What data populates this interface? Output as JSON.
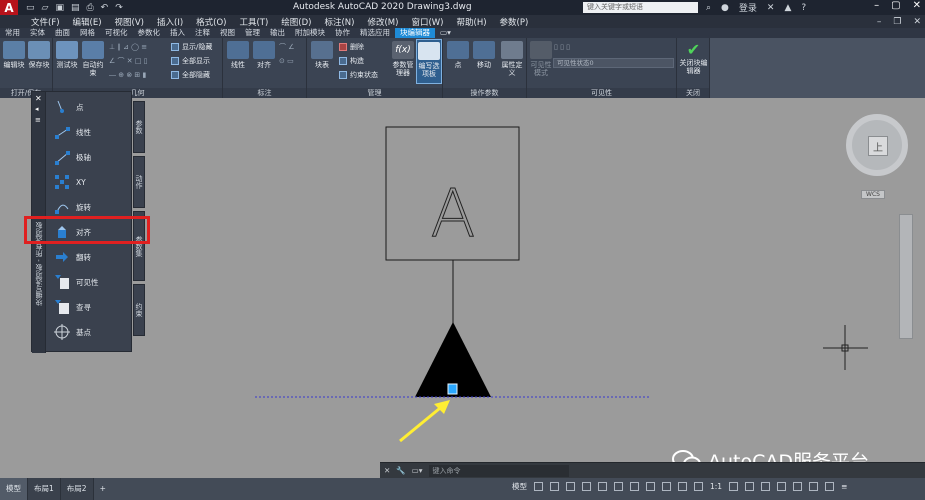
{
  "window": {
    "app_logo": "A",
    "title": "Autodesk AutoCAD 2020    Drawing3.dwg",
    "search_placeholder": "键入关键字或短语",
    "login": "登录",
    "help": "?"
  },
  "menu": [
    "文件(F)",
    "编辑(E)",
    "视图(V)",
    "插入(I)",
    "格式(O)",
    "工具(T)",
    "绘图(D)",
    "标注(N)",
    "修改(M)",
    "窗口(W)",
    "帮助(H)",
    "参数(P)"
  ],
  "ribbon_tabs": [
    {
      "label": "常用"
    },
    {
      "label": "实体"
    },
    {
      "label": "曲面"
    },
    {
      "label": "网格"
    },
    {
      "label": "可视化"
    },
    {
      "label": "参数化"
    },
    {
      "label": "插入"
    },
    {
      "label": "注释"
    },
    {
      "label": "视图"
    },
    {
      "label": "管理"
    },
    {
      "label": "输出"
    },
    {
      "label": "附加模块"
    },
    {
      "label": "协作"
    },
    {
      "label": "精选应用"
    },
    {
      "label": "块编辑器",
      "active": true
    }
  ],
  "ribbon": {
    "open_group": {
      "label": "打开/保存",
      "edit_block": "编辑块",
      "save_block": "保存块"
    },
    "geometric": {
      "label": "几何",
      "test_block": "测试块",
      "auto_constrain": "自动约束",
      "show_hide": "显示/隐藏",
      "show_all": "全部显示",
      "hide_all": "全部隐藏"
    },
    "dimension": {
      "label": "标注",
      "linear": "线性",
      "aligned": "对齐"
    },
    "manage": {
      "label": "管理",
      "block_table": "块表",
      "delete": "删除",
      "construction": "构造",
      "constraint_status": "约束状态",
      "param_manager": "参数管理器",
      "authoring_palette": "编写选项板"
    },
    "action_params": {
      "label": "操作参数",
      "point": "点",
      "move": "移动",
      "attribute_def": "属性定义"
    },
    "visibility": {
      "label": "可见性",
      "visibility_mode": "可见性模式",
      "state_combo": "可见性状态0"
    },
    "close": {
      "label": "关闭",
      "close_editor": "关闭块编辑器"
    }
  },
  "palette": {
    "title": "块编写选项板 - 所有选项板",
    "tabs": [
      "参数",
      "动作",
      "参数集",
      "约束"
    ],
    "items": [
      "点",
      "线性",
      "极轴",
      "XY",
      "旋转",
      "对齐",
      "翻转",
      "可见性",
      "查寻",
      "基点"
    ],
    "highlighted": "对齐"
  },
  "drawing": {
    "block_letter": "A",
    "accent_arrow": "#ffee33",
    "grip_color": "#2aa8ff",
    "highlight_color": "#e02020"
  },
  "viewcube": {
    "face": "上",
    "wcs": "WCS"
  },
  "command": {
    "placeholder": "键入命令"
  },
  "status": {
    "tabs": [
      {
        "label": "模型",
        "active": true
      },
      {
        "label": "布局1"
      },
      {
        "label": "布局2"
      }
    ],
    "add": "+",
    "model": "模型",
    "scale": "1:1"
  },
  "watermark": "AutoCAD服务平台"
}
